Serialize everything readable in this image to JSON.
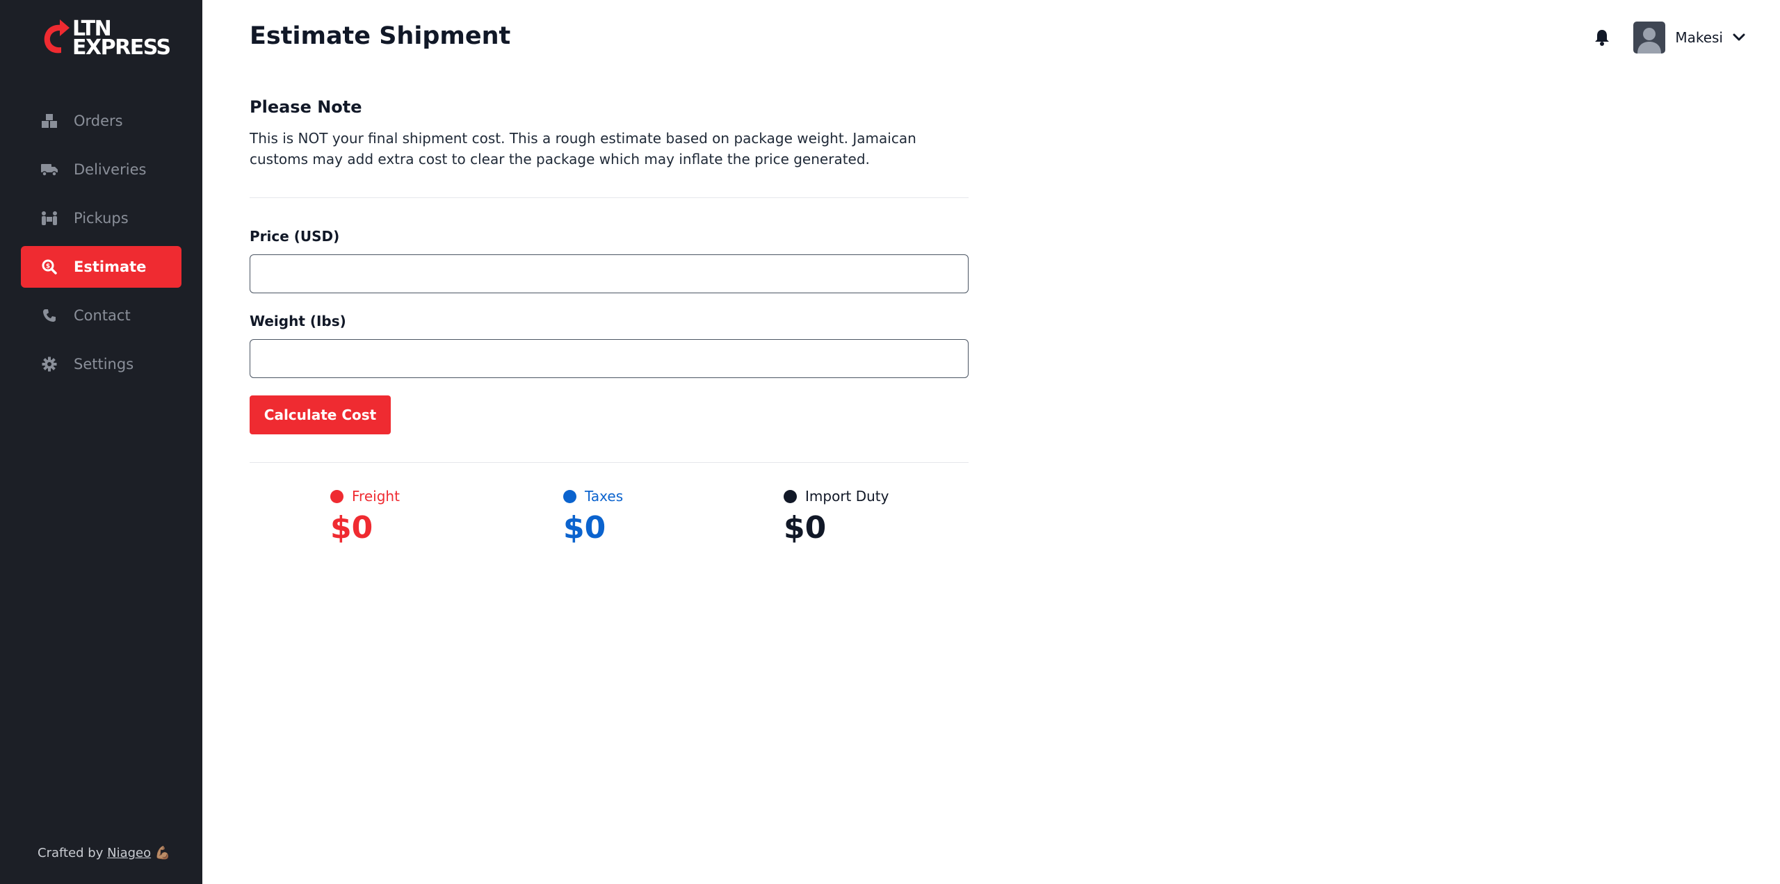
{
  "brand": {
    "line1": "LTN",
    "line2": "EXPRESS",
    "accent": "#ef2b31",
    "sidebar_bg": "#1c1f26"
  },
  "sidebar": {
    "items": [
      {
        "label": "Orders",
        "icon": "boxes-icon",
        "active": false
      },
      {
        "label": "Deliveries",
        "icon": "truck-icon",
        "active": false
      },
      {
        "label": "Pickups",
        "icon": "people-carry-icon",
        "active": false
      },
      {
        "label": "Estimate",
        "icon": "search-dollar-icon",
        "active": true
      },
      {
        "label": "Contact",
        "icon": "phone-icon",
        "active": false
      },
      {
        "label": "Settings",
        "icon": "gear-icon",
        "active": false
      }
    ],
    "credit_prefix": "Crafted by ",
    "credit_link": "Niageo",
    "credit_emoji": "💪🏽"
  },
  "header": {
    "title": "Estimate Shipment",
    "username": "Makesi"
  },
  "note": {
    "title": "Please Note",
    "text": "This is NOT your final shipment cost. This a rough estimate based on package weight. Jamaican customs may add extra cost to clear the package which may inflate the price generated."
  },
  "form": {
    "price_label": "Price (USD)",
    "price_value": "",
    "weight_label": "Weight (Ibs)",
    "weight_value": "",
    "submit_label": "Calculate Cost"
  },
  "results": [
    {
      "label": "Freight",
      "value": "$0",
      "color": "#ef2b31"
    },
    {
      "label": "Taxes",
      "value": "$0",
      "color": "#0b63ce"
    },
    {
      "label": "Import Duty",
      "value": "$0",
      "color": "#111827"
    }
  ]
}
